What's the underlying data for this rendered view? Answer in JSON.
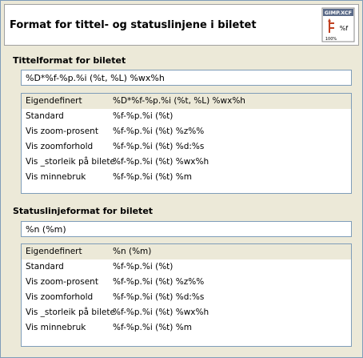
{
  "header": {
    "title": "Format for tittel- og statuslinjene i biletet",
    "icon_label_top": "GIMP.XCF",
    "icon_label_mid": "%f",
    "icon_label_bottom": "100%"
  },
  "title_section": {
    "heading": "Tittelformat for biletet",
    "input_value": "%D*%f-%p.%i (%t, %L) %wx%h",
    "rows": [
      {
        "name": "Eigendefinert",
        "format": "%D*%f-%p.%i (%t, %L) %wx%h",
        "selected": true
      },
      {
        "name": "Standard",
        "format": "%f-%p.%i (%t)",
        "selected": false
      },
      {
        "name": "Vis zoom-prosent",
        "format": "%f-%p.%i (%t) %z%%",
        "selected": false
      },
      {
        "name": "Vis zoomforhold",
        "format": "%f-%p.%i (%t) %d:%s",
        "selected": false
      },
      {
        "name": "Vis _storleik på bilete",
        "format": "%f-%p.%i (%t) %wx%h",
        "selected": false
      },
      {
        "name": "Vis minnebruk",
        "format": "%f-%p.%i (%t) %m",
        "selected": false
      }
    ]
  },
  "status_section": {
    "heading": "Statuslinjeformat for biletet",
    "input_value": "%n (%m)",
    "rows": [
      {
        "name": "Eigendefinert",
        "format": "%n (%m)",
        "selected": true
      },
      {
        "name": "Standard",
        "format": "%f-%p.%i (%t)",
        "selected": false
      },
      {
        "name": "Vis zoom-prosent",
        "format": "%f-%p.%i (%t) %z%%",
        "selected": false
      },
      {
        "name": "Vis zoomforhold",
        "format": "%f-%p.%i (%t) %d:%s",
        "selected": false
      },
      {
        "name": "Vis _storleik på bilete",
        "format": "%f-%p.%i (%t) %wx%h",
        "selected": false
      },
      {
        "name": "Vis minnebruk",
        "format": "%f-%p.%i (%t) %m",
        "selected": false
      }
    ]
  }
}
